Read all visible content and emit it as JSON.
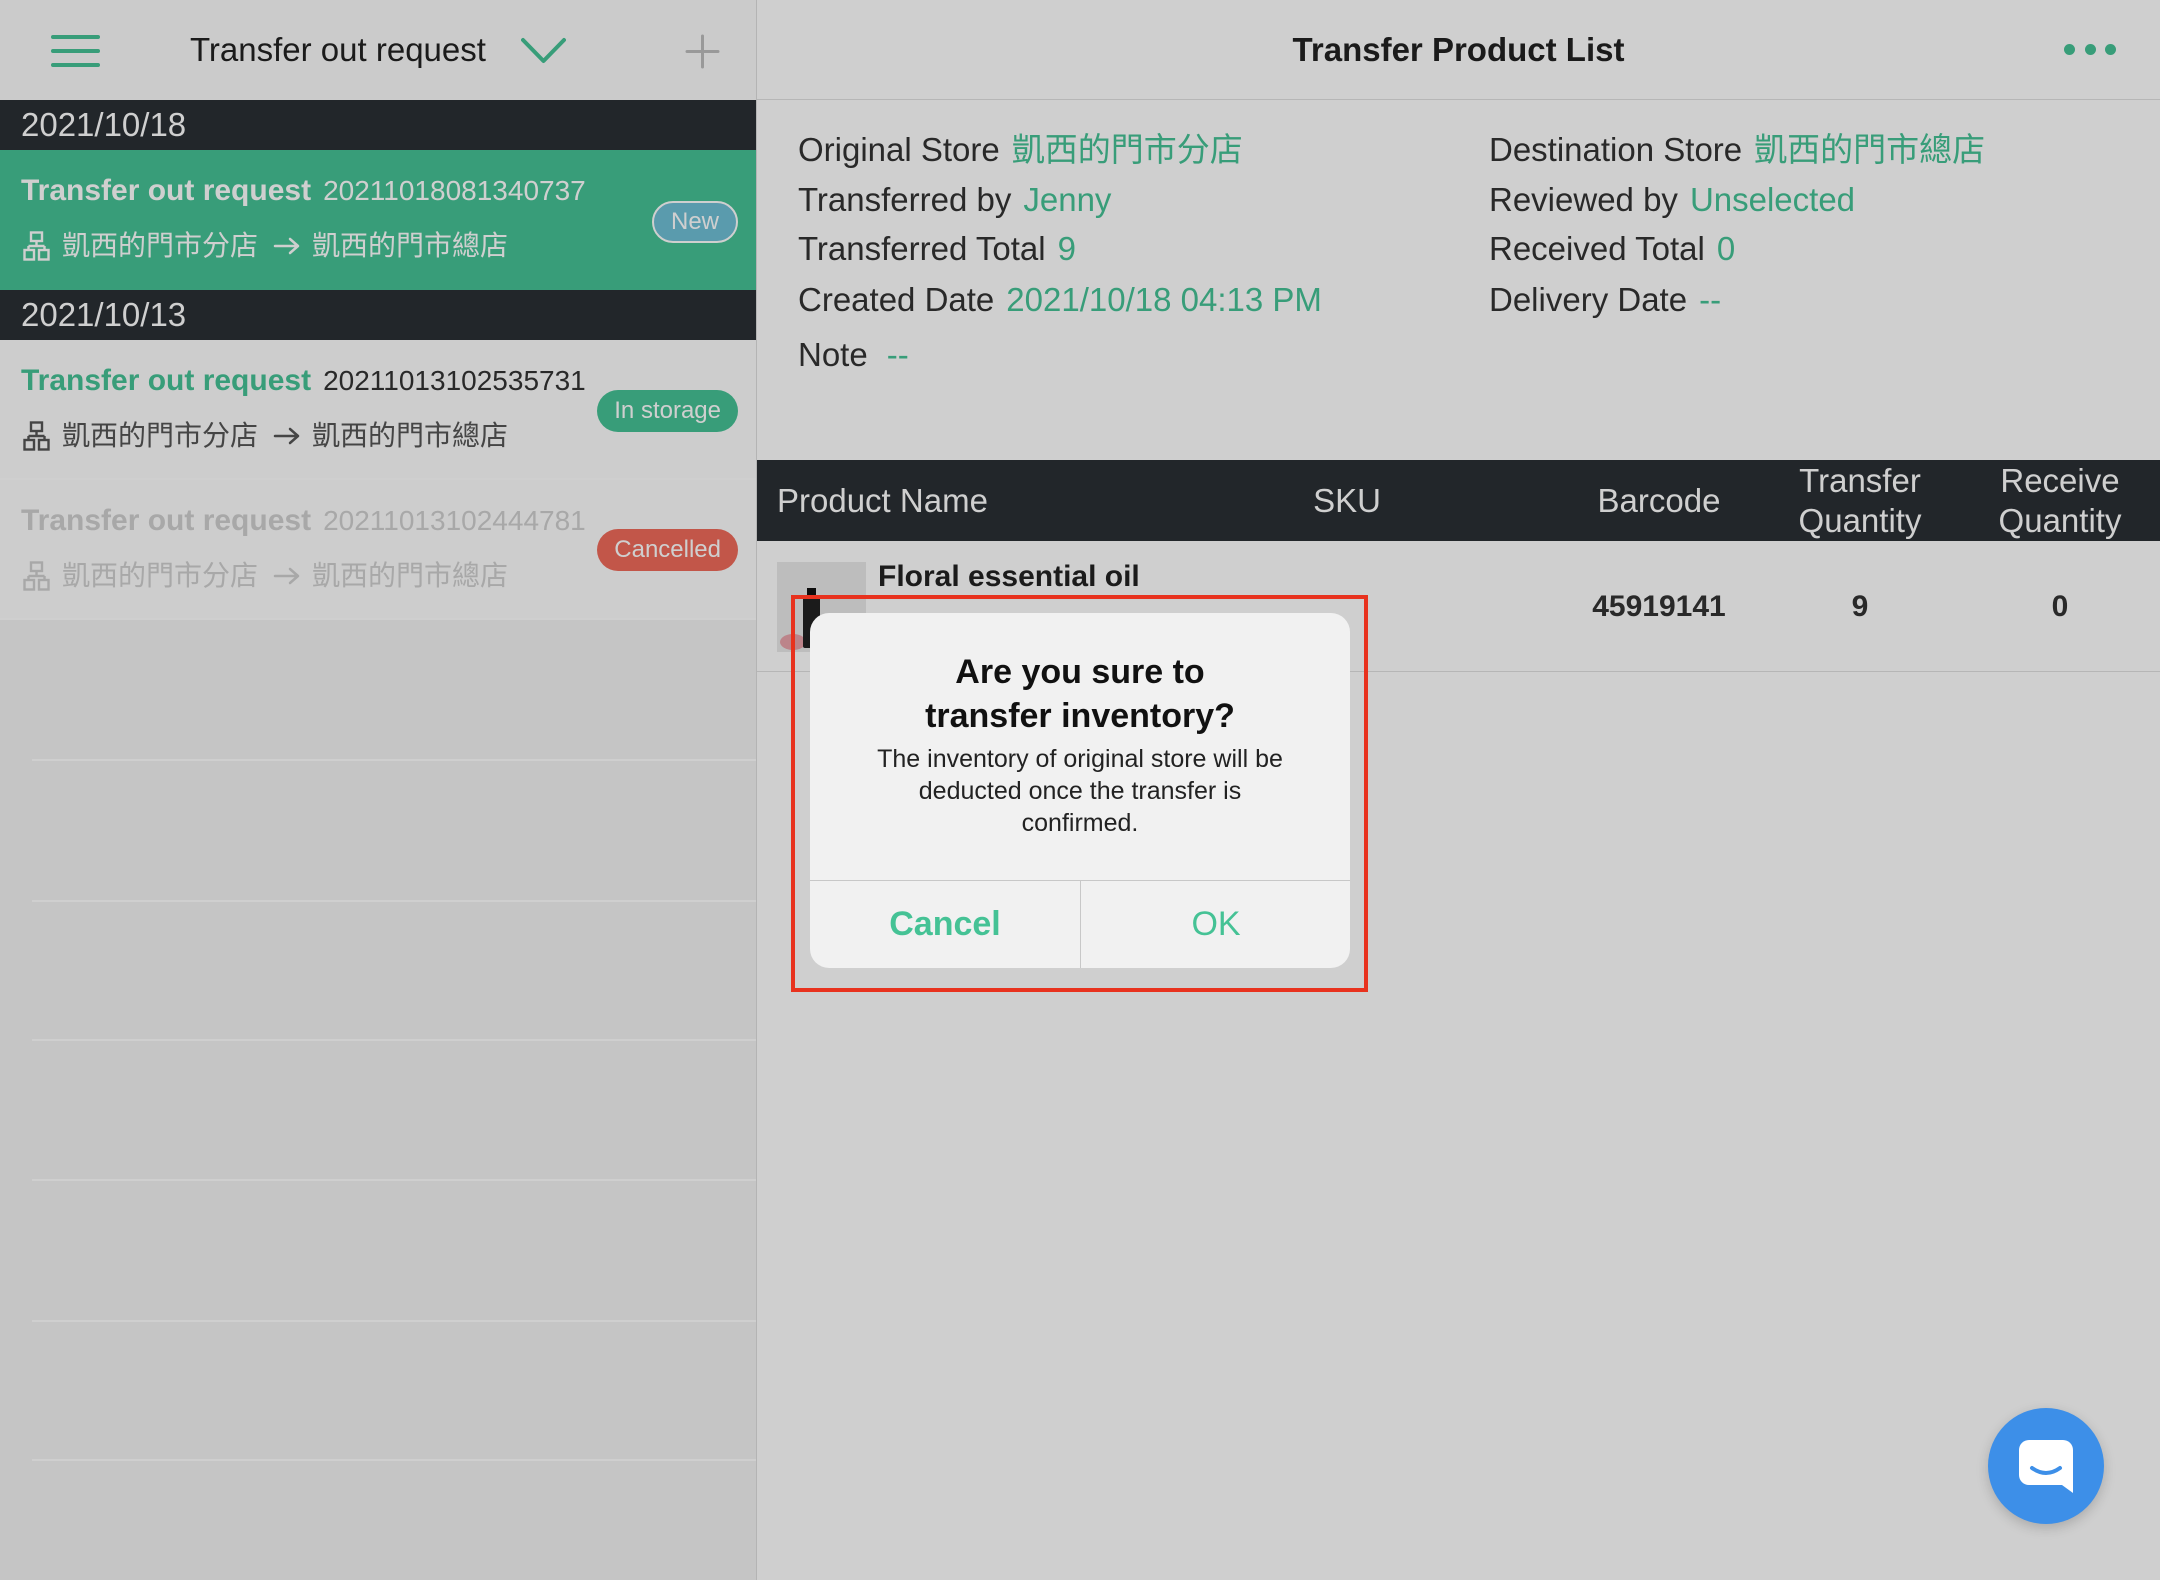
{
  "colors": {
    "accent": "#45c295",
    "dark_header": "#2a2f34",
    "badge_new": "#6fbfd6",
    "badge_in_storage": "#45c295",
    "badge_cancelled": "#ef6b5b",
    "highlight": "#e8321e",
    "chat_button": "#3d8fe8"
  },
  "left_header": {
    "title": "Transfer out request",
    "icons": {
      "menu": "hamburger-menu-icon",
      "dropdown": "chevron-down-icon",
      "add": "plus-icon"
    }
  },
  "transfer_groups": [
    {
      "date": "2021/10/18",
      "items": [
        {
          "title": "Transfer out request",
          "number": "20211018081340737",
          "from": "凱西的門市分店",
          "to": "凱西的門市總店",
          "status": "New",
          "selected": true
        }
      ]
    },
    {
      "date": "2021/10/13",
      "items": [
        {
          "title": "Transfer out request",
          "number": "20211013102535731",
          "from": "凱西的門市分店",
          "to": "凱西的門市總店",
          "status": "In storage"
        },
        {
          "title": "Transfer out request",
          "number": "20211013102444781",
          "from": "凱西的門市分店",
          "to": "凱西的門市總店",
          "status": "Cancelled"
        }
      ]
    }
  ],
  "route_icons": {
    "store": "store-hierarchy-icon",
    "arrow": "arrow-right-icon"
  },
  "detail": {
    "title": "Transfer Product List",
    "more_icon": "more-dots-icon",
    "info": {
      "original_store": {
        "label": "Original Store",
        "value": "凱西的門市分店"
      },
      "destination_store": {
        "label": "Destination Store",
        "value": "凱西的門市總店"
      },
      "transferred_by": {
        "label": "Transferred by",
        "value": "Jenny"
      },
      "reviewed_by": {
        "label": "Reviewed by",
        "value": "Unselected"
      },
      "transferred_total": {
        "label": "Transferred Total",
        "value": "9"
      },
      "received_total": {
        "label": "Received Total",
        "value": "0"
      },
      "created_date": {
        "label": "Created Date",
        "value": "2021/10/18 04:13 PM"
      },
      "delivery_date": {
        "label": "Delivery Date",
        "value": "--"
      },
      "note": {
        "label": "Note",
        "value": "--"
      }
    },
    "table": {
      "columns": [
        "Product Name",
        "SKU",
        "Barcode",
        "Transfer Quantity",
        "Receive Quantity"
      ],
      "rows": [
        {
          "product_name": "Floral essential oil",
          "barcode": "45919141",
          "transfer_quantity": "9",
          "receive_quantity": "0"
        }
      ]
    }
  },
  "dialog": {
    "title": "Are you sure to transfer inventory?",
    "message": "The inventory of original store will be deducted once the transfer is confirmed.",
    "cancel_label": "Cancel",
    "ok_label": "OK"
  },
  "chat_button": {
    "icon": "chat-bubble-icon"
  }
}
